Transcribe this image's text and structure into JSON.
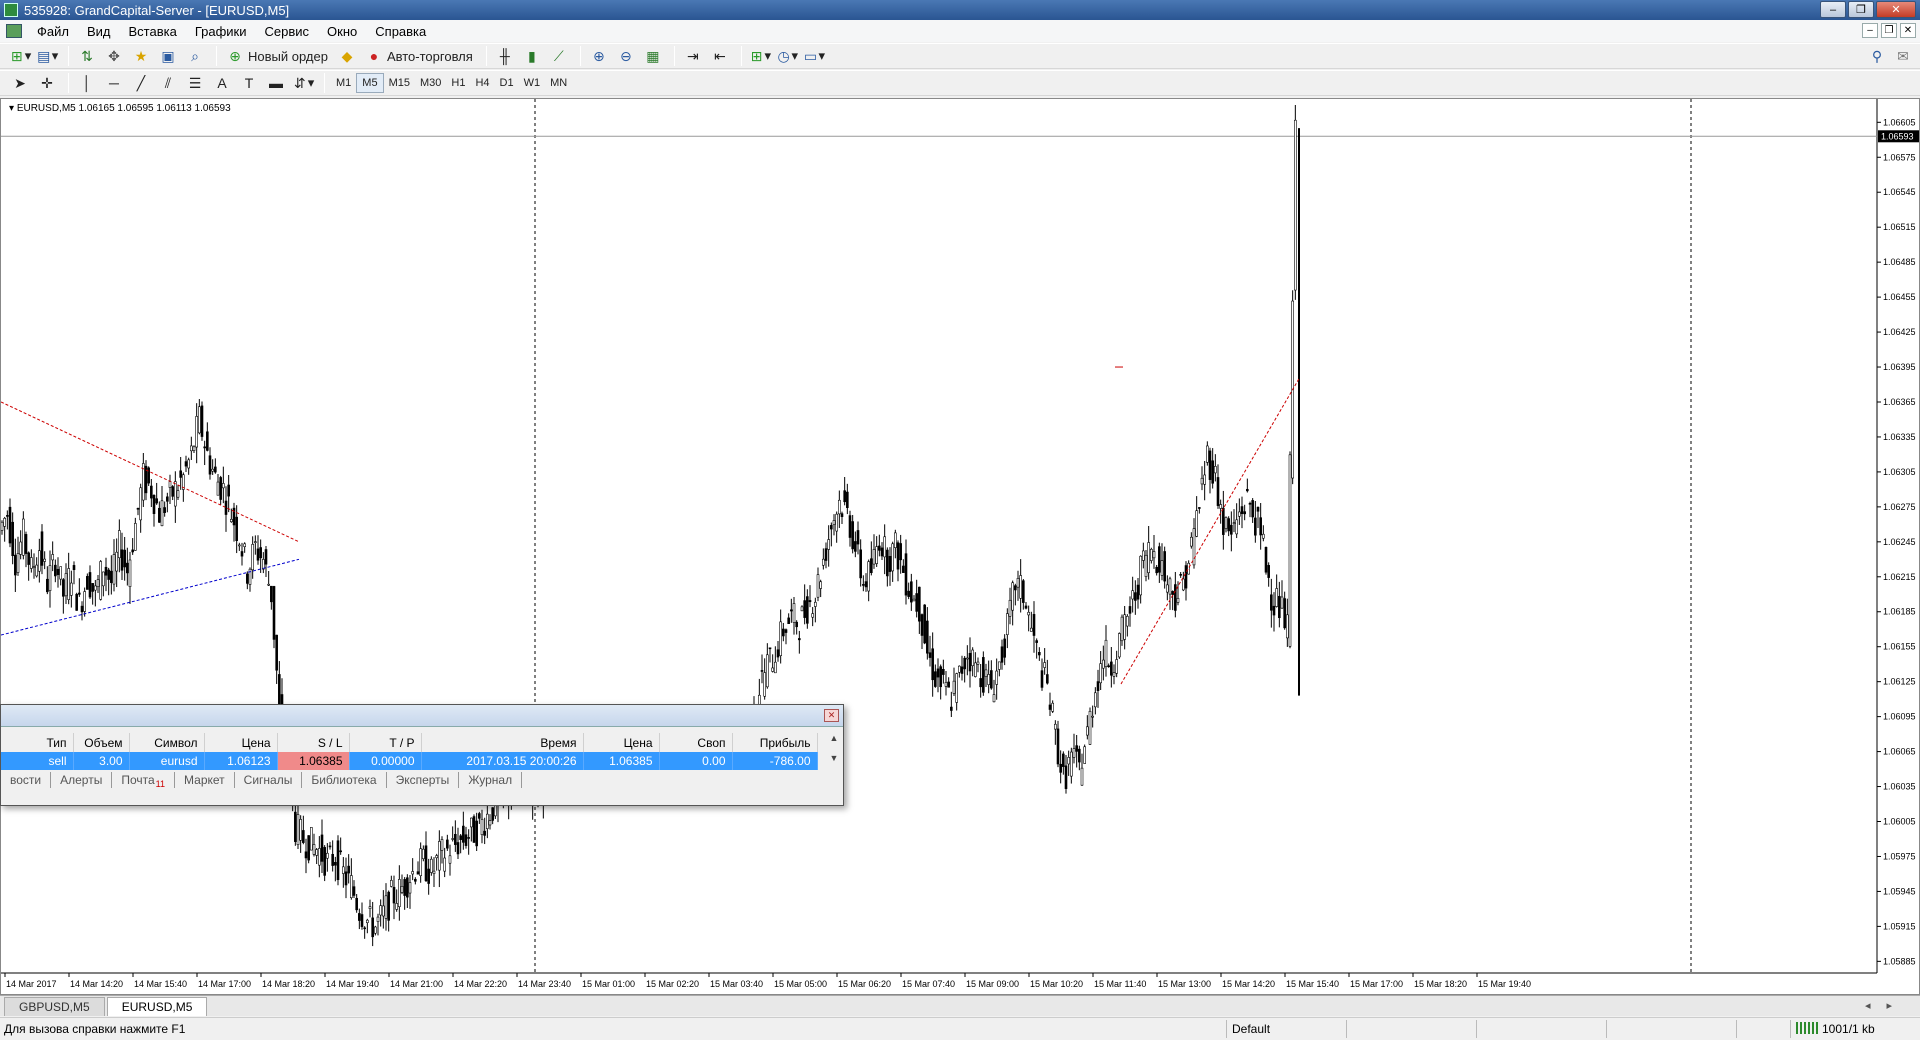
{
  "window": {
    "title": "535928: GrandCapital-Server - [EURUSD,M5]",
    "controls": [
      "–",
      "❐",
      "✕"
    ]
  },
  "menu": {
    "items": [
      "Файл",
      "Вид",
      "Вставка",
      "Графики",
      "Сервис",
      "Окно",
      "Справка"
    ]
  },
  "toolbar": {
    "new_order": "Новый ордер",
    "auto_trading": "Авто-торговля",
    "timeframes": [
      "M1",
      "M5",
      "M15",
      "M30",
      "H1",
      "H4",
      "D1",
      "W1",
      "MN"
    ],
    "active_timeframe": "M5"
  },
  "chart": {
    "info": "EURUSD,M5  1.06165 1.06595 1.06113 1.06593",
    "current_price": "1.06593",
    "colors": {
      "candle": "#000000",
      "trendline_red": "#cc0000",
      "trendline_blue": "#0000cc",
      "price_badge": "#000000"
    }
  },
  "chart_data": {
    "type": "candlestick",
    "symbol": "EURUSD",
    "timeframe": "M5",
    "price_axis_labels": [
      "1.06605",
      "1.06575",
      "1.06545",
      "1.06515",
      "1.06485",
      "1.06455",
      "1.06425",
      "1.06395",
      "1.06365",
      "1.06335",
      "1.06305",
      "1.06275",
      "1.06245",
      "1.06215",
      "1.06185",
      "1.06155",
      "1.06125",
      "1.06095",
      "1.06065",
      "1.06035",
      "1.06005",
      "1.05975",
      "1.05945",
      "1.05915",
      "1.05885"
    ],
    "time_axis_labels": [
      "14 Mar 2017",
      "14 Mar 14:20",
      "14 Mar 15:40",
      "14 Mar 17:00",
      "14 Mar 18:20",
      "14 Mar 19:40",
      "14 Mar 21:00",
      "14 Mar 22:20",
      "14 Mar 23:40",
      "15 Mar 01:00",
      "15 Mar 02:20",
      "15 Mar 03:40",
      "15 Mar 05:00",
      "15 Mar 06:20",
      "15 Mar 07:40",
      "15 Mar 09:00",
      "15 Mar 10:20",
      "15 Mar 11:40",
      "15 Mar 13:00",
      "15 Mar 14:20",
      "15 Mar 15:40",
      "15 Mar 17:00",
      "15 Mar 18:20",
      "15 Mar 19:40"
    ],
    "ylim": [
      1.05875,
      1.06625
    ],
    "close_path": [
      [
        0,
        1.06255
      ],
      [
        8,
        1.0627
      ],
      [
        16,
        1.0623
      ],
      [
        24,
        1.0625
      ],
      [
        32,
        1.0622
      ],
      [
        40,
        1.0624
      ],
      [
        48,
        1.0621
      ],
      [
        56,
        1.0623
      ],
      [
        64,
        1.062
      ],
      [
        72,
        1.0622
      ],
      [
        80,
        1.0619
      ],
      [
        88,
        1.06215
      ],
      [
        96,
        1.062
      ],
      [
        104,
        1.06225
      ],
      [
        112,
        1.0621
      ],
      [
        120,
        1.0624
      ],
      [
        128,
        1.0622
      ],
      [
        136,
        1.0626
      ],
      [
        144,
        1.063
      ],
      [
        152,
        1.0629
      ],
      [
        160,
        1.0627
      ],
      [
        168,
        1.0628
      ],
      [
        176,
        1.0629
      ],
      [
        184,
        1.063
      ],
      [
        192,
        1.0632
      ],
      [
        200,
        1.0635
      ],
      [
        208,
        1.0632
      ],
      [
        216,
        1.063
      ],
      [
        224,
        1.0629
      ],
      [
        232,
        1.0627
      ],
      [
        240,
        1.0625
      ],
      [
        248,
        1.0622
      ],
      [
        256,
        1.0624
      ],
      [
        264,
        1.0623
      ],
      [
        272,
        1.062
      ],
      [
        280,
        1.061
      ],
      [
        288,
        1.0605
      ],
      [
        296,
        1.06
      ],
      [
        304,
        1.0599
      ],
      [
        312,
        1.05985
      ],
      [
        320,
        1.0598
      ],
      [
        328,
        1.0597
      ],
      [
        336,
        1.05975
      ],
      [
        344,
        1.0596
      ],
      [
        352,
        1.0595
      ],
      [
        360,
        1.0593
      ],
      [
        368,
        1.0592
      ],
      [
        376,
        1.05915
      ],
      [
        384,
        1.05925
      ],
      [
        392,
        1.0594
      ],
      [
        400,
        1.05945
      ],
      [
        408,
        1.05955
      ],
      [
        416,
        1.05965
      ],
      [
        424,
        1.0597
      ],
      [
        432,
        1.0596
      ],
      [
        440,
        1.05975
      ],
      [
        448,
        1.0598
      ],
      [
        456,
        1.05985
      ],
      [
        464,
        1.0599
      ],
      [
        472,
        1.05995
      ],
      [
        480,
        1.06
      ],
      [
        488,
        1.0601
      ],
      [
        496,
        1.0602
      ],
      [
        504,
        1.06025
      ],
      [
        512,
        1.0603
      ],
      [
        520,
        1.06035
      ],
      [
        528,
        1.0604
      ],
      [
        536,
        1.0603
      ],
      [
        544,
        1.06035
      ],
      [
        552,
        1.0604
      ],
      [
        560,
        1.0605
      ],
      [
        568,
        1.0606
      ],
      [
        576,
        1.06055
      ],
      [
        584,
        1.0606
      ],
      [
        592,
        1.06055
      ],
      [
        600,
        1.0606
      ],
      [
        608,
        1.06065
      ],
      [
        616,
        1.0606
      ],
      [
        624,
        1.0607
      ],
      [
        632,
        1.06065
      ],
      [
        640,
        1.0607
      ],
      [
        648,
        1.06065
      ],
      [
        656,
        1.0606
      ],
      [
        664,
        1.0607
      ],
      [
        672,
        1.06065
      ],
      [
        680,
        1.0606
      ],
      [
        688,
        1.0607
      ],
      [
        696,
        1.06065
      ],
      [
        704,
        1.0606
      ],
      [
        712,
        1.0605
      ],
      [
        720,
        1.06045
      ],
      [
        728,
        1.06055
      ],
      [
        736,
        1.0606
      ],
      [
        744,
        1.0607
      ],
      [
        752,
        1.0609
      ],
      [
        760,
        1.0612
      ],
      [
        768,
        1.0614
      ],
      [
        776,
        1.0615
      ],
      [
        784,
        1.0617
      ],
      [
        792,
        1.0618
      ],
      [
        800,
        1.06175
      ],
      [
        808,
        1.0619
      ],
      [
        816,
        1.062
      ],
      [
        824,
        1.0623
      ],
      [
        832,
        1.0626
      ],
      [
        840,
        1.0628
      ],
      [
        848,
        1.0627
      ],
      [
        856,
        1.0624
      ],
      [
        864,
        1.0621
      ],
      [
        872,
        1.0622
      ],
      [
        880,
        1.0625
      ],
      [
        888,
        1.0623
      ],
      [
        896,
        1.0624
      ],
      [
        904,
        1.0622
      ],
      [
        912,
        1.062
      ],
      [
        920,
        1.0619
      ],
      [
        928,
        1.0615
      ],
      [
        936,
        1.0613
      ],
      [
        944,
        1.0612
      ],
      [
        952,
        1.0611
      ],
      [
        960,
        1.0613
      ],
      [
        968,
        1.0615
      ],
      [
        976,
        1.0614
      ],
      [
        984,
        1.0613
      ],
      [
        992,
        1.0612
      ],
      [
        1000,
        1.0614
      ],
      [
        1008,
        1.0617
      ],
      [
        1016,
        1.0621
      ],
      [
        1024,
        1.062
      ],
      [
        1032,
        1.0617
      ],
      [
        1040,
        1.0614
      ],
      [
        1048,
        1.0612
      ],
      [
        1056,
        1.0608
      ],
      [
        1064,
        1.0604
      ],
      [
        1072,
        1.0606
      ],
      [
        1080,
        1.0605
      ],
      [
        1088,
        1.0608
      ],
      [
        1096,
        1.0612
      ],
      [
        1104,
        1.0615
      ],
      [
        1112,
        1.0614
      ],
      [
        1120,
        1.0616
      ],
      [
        1128,
        1.0618
      ],
      [
        1136,
        1.062
      ],
      [
        1144,
        1.0623
      ],
      [
        1152,
        1.0624
      ],
      [
        1160,
        1.0623
      ],
      [
        1168,
        1.0621
      ],
      [
        1176,
        1.062
      ],
      [
        1184,
        1.0621
      ],
      [
        1192,
        1.0624
      ],
      [
        1200,
        1.0628
      ],
      [
        1208,
        1.0632
      ],
      [
        1216,
        1.063
      ],
      [
        1224,
        1.0626
      ],
      [
        1232,
        1.0625
      ],
      [
        1240,
        1.0627
      ],
      [
        1248,
        1.0628
      ],
      [
        1256,
        1.06265
      ],
      [
        1264,
        1.0624
      ],
      [
        1272,
        1.062
      ],
      [
        1280,
        1.0619
      ],
      [
        1288,
        1.0617
      ],
      [
        1296,
        1.06593
      ]
    ]
  },
  "terminal": {
    "columns": [
      "Тип",
      "Объем",
      "Символ",
      "Цена",
      "S / L",
      "T / P",
      "Время",
      "Цена",
      "Своп",
      "Прибыль"
    ],
    "rows": [
      [
        "sell",
        "3.00",
        "eurusd",
        "1.06123",
        "1.06385",
        "0.00000",
        "2017.03.15 20:00:26",
        "1.06385",
        "0.00",
        "-786.00"
      ]
    ],
    "tabs": [
      "вости",
      "Алерты",
      "Почта",
      "Маркет",
      "Сигналы",
      "Библиотека",
      "Эксперты",
      "Журнал"
    ],
    "mail_badge": "11"
  },
  "chart_tabs": [
    "GBPUSD,M5",
    "EURUSD,M5"
  ],
  "active_chart_tab": "EURUSD,M5",
  "status": {
    "help": "Для вызова справки нажмите F1",
    "profile": "Default",
    "traffic": "1001/1 kb"
  }
}
